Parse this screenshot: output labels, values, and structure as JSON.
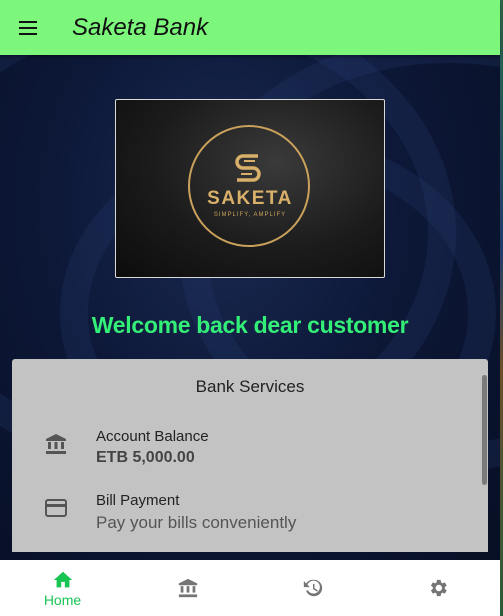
{
  "appbar": {
    "title": "Saketa Bank",
    "menu_icon": "menu-icon"
  },
  "logo": {
    "word": "SAKETA",
    "tagline": "SIMPLIFY, AMPLIFY"
  },
  "welcome_text": "Welcome back dear customer",
  "services": {
    "title": "Bank Services",
    "items": [
      {
        "icon": "bank-icon",
        "title": "Account Balance",
        "subtitle": "ETB 5,000.00"
      },
      {
        "icon": "credit-card-icon",
        "title": "Bill Payment",
        "subtitle": "Pay your bills conveniently"
      }
    ]
  },
  "bottom_nav": {
    "items": [
      {
        "icon": "home-icon",
        "label": "Home",
        "active": true
      },
      {
        "icon": "bank-icon",
        "label": ""
      },
      {
        "icon": "history-icon",
        "label": ""
      },
      {
        "icon": "settings-icon",
        "label": ""
      }
    ]
  },
  "colors": {
    "appbar": "#7cf77c",
    "accent": "#33ee77",
    "active_nav": "#18c452",
    "card": "#c3c3c3"
  }
}
